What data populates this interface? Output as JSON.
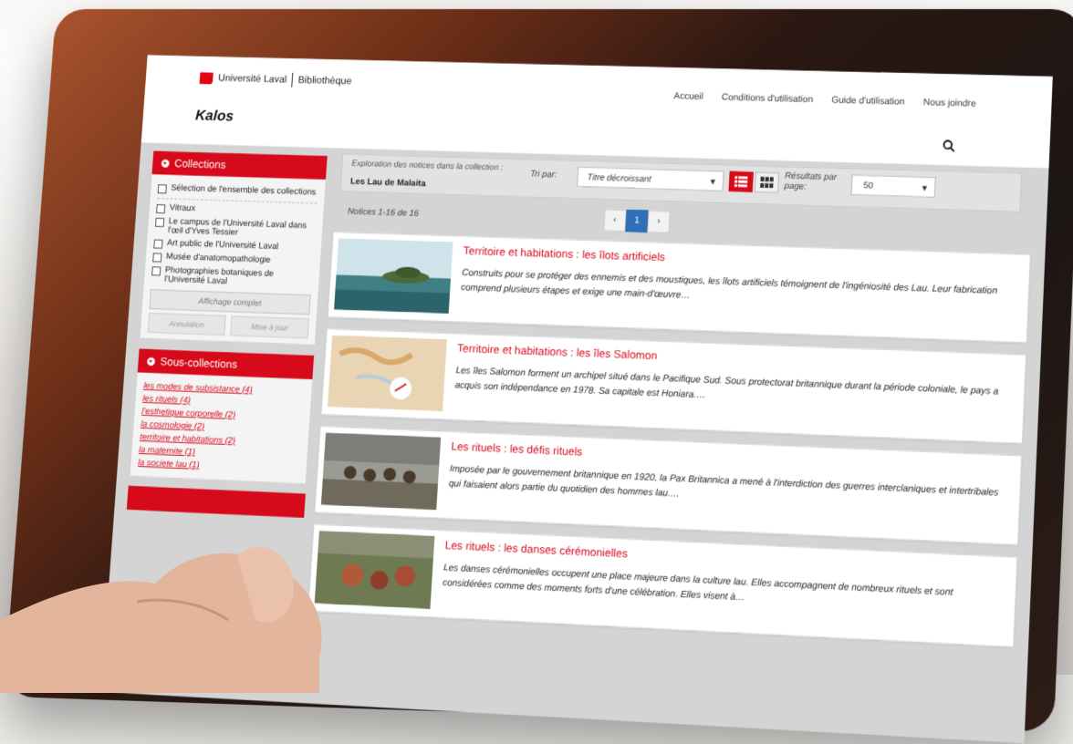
{
  "header": {
    "university": "Université Laval",
    "library": "Bibliothèque",
    "app_title": "Kalos",
    "nav": [
      "Accueil",
      "Conditions d'utilisation",
      "Guide d'utilisation",
      "Nous joindre"
    ]
  },
  "sidebar": {
    "collections": {
      "title": "Collections",
      "select_all": "Sélection de l'ensemble des collections",
      "items": [
        "Vitraux",
        "Le campus de l'Université Laval dans l'œil d'Yves Tessier",
        "Art public de l'Université Laval",
        "Musée d'anatomopathologie",
        "Photographies botaniques de l'Université Laval"
      ],
      "full_display": "Affichage complet",
      "cancel": "Annulation",
      "update": "Mise à jour"
    },
    "subcollections": {
      "title": "Sous-collections",
      "items": [
        "les modes de subsistance (4)",
        "les rituels (4)",
        "l'esthetique corporelle (2)",
        "la cosmologie (2)",
        "territoire et habitations (2)",
        "la maternite (1)",
        "la societe lau (1)"
      ]
    }
  },
  "toolbar": {
    "exploration_label": "Exploration des notices dans la collection :",
    "collection_name": "Les Lau de Malaita",
    "sort_label": "Tri par:",
    "sort_value": "Titre décroissant",
    "results_label": "Résultats par page:",
    "results_value": "50"
  },
  "listing": {
    "count": "Notices 1-16 de 16",
    "pages": [
      "‹",
      "1",
      "›"
    ]
  },
  "results": [
    {
      "title": "Territoire et habitations : les îlots artificiels",
      "description": "Construits pour se protéger des ennemis et des moustiques, les îlots artificiels témoignent de l'ingéniosité des Lau. Leur fabrication comprend plusieurs étapes et exige une main-d'œuvre…"
    },
    {
      "title": "Territoire et habitations : les îles Salomon",
      "description": "Les îles Salomon forment un archipel situé dans le Pacifique Sud. Sous protectorat britannique durant la période coloniale, le pays a acquis son indépendance en 1978. Sa capitale est Honiara.…"
    },
    {
      "title": "Les rituels : les défis rituels",
      "description": "Imposée par le gouvernement britannique en 1920, la Pax Britannica a mené à l'interdiction des guerres interclaniques et intertribales qui faisaient alors partie du quotidien des hommes lau.…"
    },
    {
      "title": "Les rituels : les danses cérémonielles",
      "description": "Les danses cérémonielles occupent une place majeure dans la culture lau. Elles accompagnent de nombreux rituels et sont considérées comme des moments forts d'une célébration. Elles visent à…"
    }
  ],
  "colors": {
    "accent": "#d70a1b",
    "pager_active": "#2f6fb5",
    "bezel": "#1c1614"
  }
}
